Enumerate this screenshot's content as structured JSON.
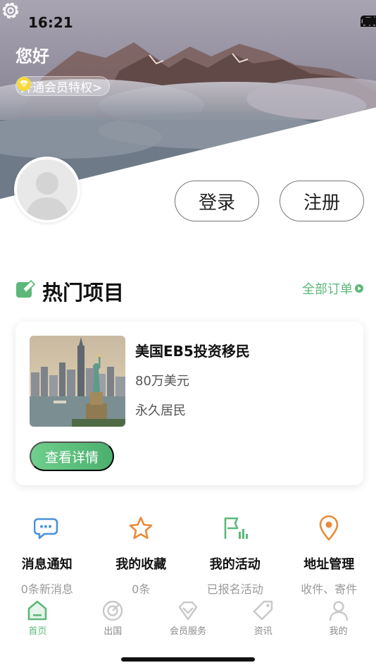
{
  "status_bar": {
    "time": "16:21"
  },
  "header": {
    "greeting": "您好",
    "vip_label": "开通会员特权>"
  },
  "auth": {
    "login_label": "登录",
    "register_label": "注册"
  },
  "hot_projects": {
    "title": "热门项目",
    "all_orders_label": "全部订单",
    "card": {
      "title": "美国EB5投资移民",
      "price": "80万美元",
      "tag": "永久居民",
      "detail_button": "查看详情"
    }
  },
  "actions": [
    {
      "icon": "message-icon",
      "title": "消息通知",
      "sub": "0条新消息",
      "color": "#4a90d9"
    },
    {
      "icon": "star-icon",
      "title": "我的收藏",
      "sub": "0条",
      "color": "#e98b3a"
    },
    {
      "icon": "activity-icon",
      "title": "我的活动",
      "sub": "已报名活动",
      "color": "#5cb87a"
    },
    {
      "icon": "location-icon",
      "title": "地址管理",
      "sub": "收件、寄件",
      "color": "#e98b3a"
    }
  ],
  "tabbar": [
    {
      "icon": "home-icon",
      "label": "首页",
      "active": true
    },
    {
      "icon": "target-icon",
      "label": "出国",
      "active": false
    },
    {
      "icon": "diamond-icon",
      "label": "会员服务",
      "active": false
    },
    {
      "icon": "tag-icon",
      "label": "资讯",
      "active": false
    },
    {
      "icon": "user-icon",
      "label": "我的",
      "active": false
    }
  ],
  "colors": {
    "accent": "#5cb87a",
    "orange": "#e98b3a",
    "blue": "#4a90d9",
    "vip_gold": "#f5d93a"
  }
}
